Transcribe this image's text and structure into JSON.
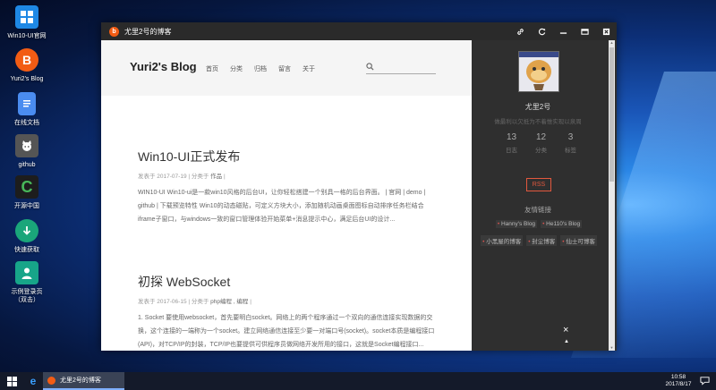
{
  "desktop": {
    "icons": [
      {
        "label": "Win10-UI官网",
        "icon": "windows-icon",
        "color": "#1e88e5"
      },
      {
        "label": "Yuri2's Blog",
        "icon": "blogger-icon",
        "color": "#f25c14"
      },
      {
        "label": "在线文档",
        "icon": "document-icon",
        "color": "#4a8cf0"
      },
      {
        "label": "github",
        "icon": "github-icon",
        "color": "#555555"
      },
      {
        "label": "开源中国",
        "icon": "oschina-icon",
        "color": "#2a8c3e"
      },
      {
        "label": "快速获取",
        "icon": "download-icon",
        "color": "#1aa67a"
      },
      {
        "label": "示例登录页\n（双击）",
        "icon": "user-icon",
        "color": "#17a589"
      }
    ]
  },
  "window": {
    "title": "尤里2号的博客",
    "buttons": [
      "link-icon",
      "refresh-icon",
      "minimize-icon",
      "maximize-icon",
      "close-icon"
    ]
  },
  "blog": {
    "logo": "Yuri2's Blog",
    "nav": [
      "首页",
      "分类",
      "归档",
      "留言",
      "关于"
    ],
    "posts": [
      {
        "title": "Win10-UI正式发布",
        "meta_prefix": "发表于 2017-07-19  |  分类于",
        "category": "作品",
        "meta_suffix": "|",
        "excerpt": "WIN10-UI Win10-ui是一款win10风格的后台UI，让你轻松搭建一个别具一格的后台界面。 | 官网 | demo | github | 下载预览特性 Win10的动态磁贴，可定义方块大小，添加随机动画桌面图标自动排序任务栏结合iframe子窗口，与windows一致的窗口管理体验开始菜单+消息提示中心，满足后台UI的设计..."
      },
      {
        "title": "初探 WebSocket",
        "meta_prefix": "发表于 2017-06-15  |  分类于",
        "category": "php编程 , 编程",
        "meta_suffix": "|",
        "excerpt": "1. Socket 要使用websocket，首先要明白socket。网络上的两个程序通过一个双向的通信连接实现数据的交换，这个连接的一端称为一个socket。建立网络通信连接至少要一对端口号(socket)。socket本质是编程接口(API)，对TCP/IP的封装，TCP/IP也要提供可供程序员做网络开发所用的接口，这就是Socket编程接口..."
      }
    ]
  },
  "sidebar": {
    "name": "尤里2号",
    "desc": "做最利以欠抵为不着惟实现以泉周",
    "stats": [
      {
        "num": "13",
        "label": "日志"
      },
      {
        "num": "12",
        "label": "分类"
      },
      {
        "num": "3",
        "label": "标签"
      }
    ],
    "rss": "RSS",
    "friends_title": "友情链接",
    "friends": [
      "Hanny's Blog",
      "He110's Blog",
      "小黑屋的博客",
      "封尘博客",
      "仙士可博客"
    ],
    "close": "×",
    "up": "▲"
  },
  "taskbar": {
    "task_title": "尤里2号的博客",
    "time": "10:58",
    "date": "2017/8/17"
  }
}
